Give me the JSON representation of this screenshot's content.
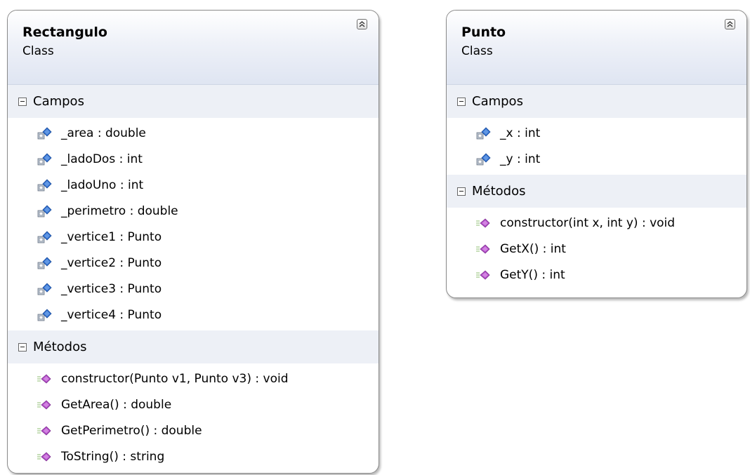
{
  "classes": [
    {
      "name": "Rectangulo",
      "kind": "Class",
      "sections": [
        {
          "title": "Campos",
          "members": [
            "_area : double",
            "_ladoDos : int",
            "_ladoUno : int",
            "_perimetro : double",
            "_vertice1 : Punto",
            "_vertice2 : Punto",
            "_vertice3 : Punto",
            "_vertice4 : Punto"
          ]
        },
        {
          "title": "Métodos",
          "members": [
            "constructor(Punto v1, Punto v3) : void",
            "GetArea() : double",
            "GetPerimetro() : double",
            "ToString() : string"
          ]
        }
      ]
    },
    {
      "name": "Punto",
      "kind": "Class",
      "sections": [
        {
          "title": "Campos",
          "members": [
            "_x : int",
            "_y : int"
          ]
        },
        {
          "title": "Métodos",
          "members": [
            "constructor(int x, int y) : void",
            "GetX() : int",
            "GetY() : int"
          ]
        }
      ]
    }
  ],
  "icons": {
    "field": "private-field-icon",
    "method": "public-method-icon",
    "collapse": "collapse-chevron-icon",
    "section_toggle": "section-collapse-icon"
  },
  "colors": {
    "header_gradient_end": "#dfe5f2",
    "section_band": "#edf0f6",
    "border": "#8a8a8a",
    "field_icon_blue": "#2f6fd0",
    "method_icon_purple": "#b24fc7"
  }
}
